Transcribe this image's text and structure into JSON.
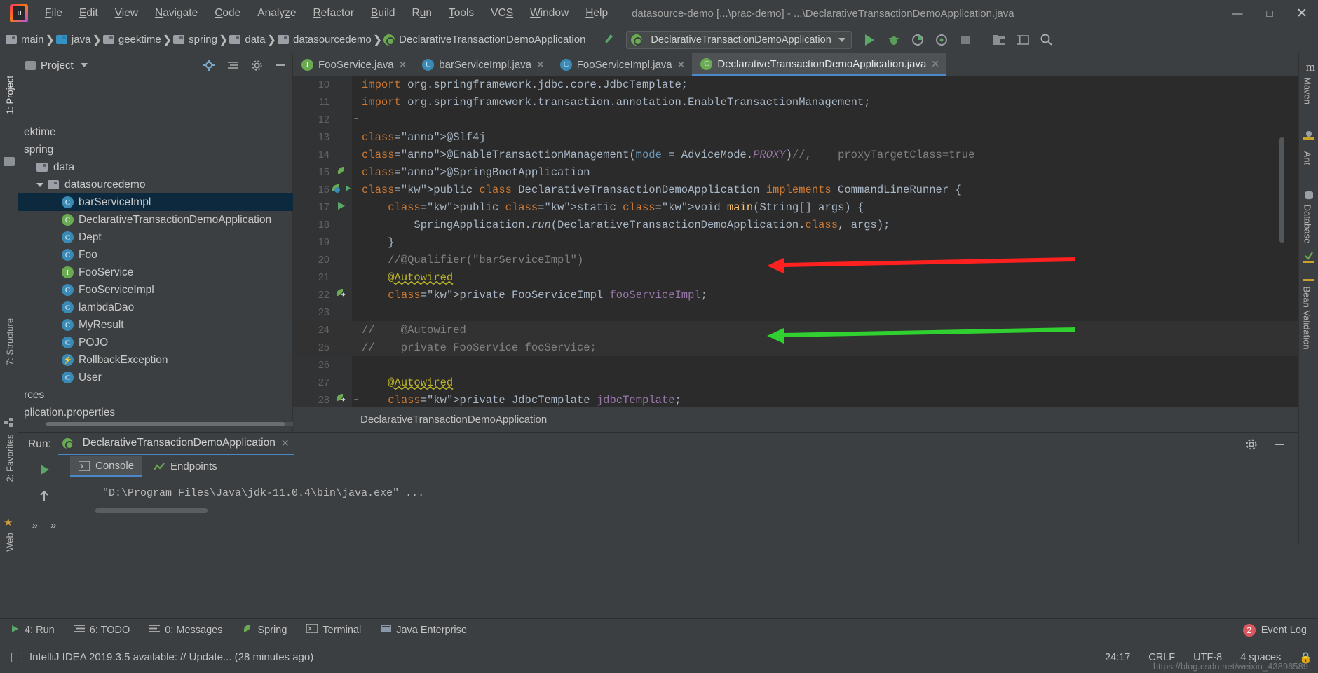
{
  "window": {
    "title": "datasource-demo [...\\prac-demo] - ...\\DeclarativeTransactionDemoApplication.java",
    "minimize": "—",
    "maximize": "□",
    "close": "✕",
    "logo_text": "IJ"
  },
  "menu": {
    "items": [
      {
        "label": "File",
        "mn": "F"
      },
      {
        "label": "Edit",
        "mn": "E"
      },
      {
        "label": "View",
        "mn": "V"
      },
      {
        "label": "Navigate",
        "mn": "N"
      },
      {
        "label": "Code",
        "mn": "C"
      },
      {
        "label": "Analyze",
        "mn": "z"
      },
      {
        "label": "Refactor",
        "mn": "R"
      },
      {
        "label": "Build",
        "mn": "B"
      },
      {
        "label": "Run",
        "mn": "u"
      },
      {
        "label": "Tools",
        "mn": "T"
      },
      {
        "label": "VCS",
        "mn": "S"
      },
      {
        "label": "Window",
        "mn": "W"
      },
      {
        "label": "Help",
        "mn": "H"
      }
    ]
  },
  "navbar": {
    "crumbs": [
      {
        "label": "main",
        "icon": "folder-icon"
      },
      {
        "label": "java",
        "icon": "folder-blue-icon"
      },
      {
        "label": "geektime",
        "icon": "folder-icon"
      },
      {
        "label": "spring",
        "icon": "folder-icon"
      },
      {
        "label": "data",
        "icon": "folder-icon"
      },
      {
        "label": "datasourcedemo",
        "icon": "folder-icon"
      },
      {
        "label": "DeclarativeTransactionDemoApplication",
        "icon": "spring-class-icon"
      }
    ],
    "run_config": "DeclarativeTransactionDemoApplication",
    "toolbar_icons": [
      "run-icon",
      "debug-icon",
      "run-coverage-icon",
      "profiler-icon",
      "stop-icon",
      "project-structure-icon",
      "settings-icon",
      "search-icon"
    ],
    "build_icon": "hammer-icon"
  },
  "left_strip": {
    "tabs": [
      "1: Project",
      "7: Structure",
      "2: Favorites"
    ]
  },
  "right_strip": {
    "tabs": [
      "Maven",
      "Ant",
      "Database",
      "Bean Validation"
    ]
  },
  "project_panel": {
    "title": "Project",
    "header_icons": [
      "locate-icon",
      "collapse-all-icon",
      "gear-icon",
      "hide-icon"
    ],
    "tree": [
      {
        "label": "ektime",
        "indent": 0,
        "icon": "none",
        "selected": false,
        "expander": false
      },
      {
        "label": "spring",
        "indent": 0,
        "icon": "none",
        "selected": false,
        "expander": false
      },
      {
        "label": "data",
        "indent": 1,
        "icon": "folder",
        "selected": false,
        "expander": false
      },
      {
        "label": "datasourcedemo",
        "indent": 1,
        "icon": "folder",
        "selected": false,
        "expander": true
      },
      {
        "label": "barServiceImpl",
        "indent": 3,
        "icon": "class",
        "selected": true,
        "expander": false
      },
      {
        "label": "DeclarativeTransactionDemoApplication",
        "indent": 3,
        "icon": "spring",
        "selected": false,
        "expander": false
      },
      {
        "label": "Dept",
        "indent": 3,
        "icon": "class",
        "selected": false,
        "expander": false
      },
      {
        "label": "Foo",
        "indent": 3,
        "icon": "class",
        "selected": false,
        "expander": false
      },
      {
        "label": "FooService",
        "indent": 3,
        "icon": "interface",
        "selected": false,
        "expander": false
      },
      {
        "label": "FooServiceImpl",
        "indent": 3,
        "icon": "class",
        "selected": false,
        "expander": false
      },
      {
        "label": "lambdaDao",
        "indent": 3,
        "icon": "class",
        "selected": false,
        "expander": false
      },
      {
        "label": "MyResult",
        "indent": 3,
        "icon": "class",
        "selected": false,
        "expander": false
      },
      {
        "label": "POJO",
        "indent": 3,
        "icon": "class",
        "selected": false,
        "expander": false
      },
      {
        "label": "RollbackException",
        "indent": 3,
        "icon": "exception",
        "selected": false,
        "expander": false
      },
      {
        "label": "User",
        "indent": 3,
        "icon": "class",
        "selected": false,
        "expander": false
      },
      {
        "label": "rces",
        "indent": 0,
        "icon": "none",
        "selected": false,
        "expander": false
      },
      {
        "label": "plication.properties",
        "indent": 0,
        "icon": "none",
        "selected": false,
        "expander": false
      }
    ]
  },
  "editor": {
    "tabs": [
      {
        "label": "FooService.java",
        "icon": "interface",
        "active": false,
        "close": "✕"
      },
      {
        "label": "barServiceImpl.java",
        "icon": "class",
        "active": false,
        "close": "✕"
      },
      {
        "label": "FooServiceImpl.java",
        "icon": "class",
        "active": false,
        "close": "✕"
      },
      {
        "label": "DeclarativeTransactionDemoApplication.java",
        "icon": "spring",
        "active": true,
        "close": "✕"
      }
    ],
    "breadcrumb": "DeclarativeTransactionDemoApplication",
    "lines": [
      {
        "n": "10",
        "gutter": "",
        "fold": "",
        "text": "import org.springframework.jdbc.core.JdbcTemplate;"
      },
      {
        "n": "11",
        "gutter": "",
        "fold": "−",
        "text": "import org.springframework.transaction.annotation.EnableTransactionManagement;"
      },
      {
        "n": "12",
        "gutter": "",
        "fold": "",
        "text": ""
      },
      {
        "n": "13",
        "gutter": "",
        "fold": "−",
        "text": "@Slf4j"
      },
      {
        "n": "14",
        "gutter": "",
        "fold": "",
        "text": "@EnableTransactionManagement(mode = AdviceMode.PROXY)//,    proxyTargetClass=true"
      },
      {
        "n": "15",
        "gutter": "spring",
        "fold": "−",
        "text": "@SpringBootApplication"
      },
      {
        "n": "16",
        "gutter": "spring-run",
        "fold": "",
        "text": "public class DeclarativeTransactionDemoApplication implements CommandLineRunner {"
      },
      {
        "n": "17",
        "gutter": "run",
        "fold": "−",
        "text": "    public static void main(String[] args) {"
      },
      {
        "n": "18",
        "gutter": "",
        "fold": "",
        "text": "        SpringApplication.run(DeclarativeTransactionDemoApplication.class, args);"
      },
      {
        "n": "19",
        "gutter": "",
        "fold": "−",
        "text": "    }"
      },
      {
        "n": "20",
        "gutter": "",
        "fold": "",
        "text": "    //@Qualifier(\"barServiceImpl\")"
      },
      {
        "n": "21",
        "gutter": "",
        "fold": "",
        "text": "    @Autowired"
      },
      {
        "n": "22",
        "gutter": "bean",
        "fold": "",
        "text": "    private FooServiceImpl fooServiceImpl;"
      },
      {
        "n": "23",
        "gutter": "",
        "fold": "",
        "text": ""
      },
      {
        "n": "24",
        "gutter": "",
        "fold": "−",
        "text": "//    @Autowired"
      },
      {
        "n": "25",
        "gutter": "",
        "fold": "−",
        "text": "//    private FooService fooService;"
      },
      {
        "n": "26",
        "gutter": "",
        "fold": "",
        "text": ""
      },
      {
        "n": "27",
        "gutter": "",
        "fold": "",
        "text": "    @Autowired"
      },
      {
        "n": "28",
        "gutter": "bean",
        "fold": "",
        "text": "    private JdbcTemplate jdbcTemplate;"
      }
    ]
  },
  "run_panel": {
    "label": "Run:",
    "config_name": "DeclarativeTransactionDemoApplication",
    "close": "✕",
    "tabs": [
      {
        "label": "Console",
        "icon": "console-icon",
        "active": true
      },
      {
        "label": "Endpoints",
        "icon": "endpoints-icon",
        "active": false
      }
    ],
    "side_icons": [
      "rerun-icon",
      "scroll-up-icon",
      "more-icon",
      "more2-icon"
    ],
    "console_text": "\"D:\\Program Files\\Java\\jdk-11.0.4\\bin\\java.exe\" ...",
    "right_icons": [
      "gear-icon",
      "hide-icon"
    ]
  },
  "bottom_bar": {
    "items": [
      {
        "label": "4: Run",
        "mn": "4",
        "icon": "run-icon"
      },
      {
        "label": "6: TODO",
        "mn": "6",
        "icon": "todo-icon"
      },
      {
        "label": "0: Messages",
        "mn": "0",
        "icon": "messages-icon"
      },
      {
        "label": "Spring",
        "mn": "",
        "icon": "spring-icon"
      },
      {
        "label": "Terminal",
        "mn": "",
        "icon": "terminal-icon"
      },
      {
        "label": "Java Enterprise",
        "mn": "",
        "icon": "java-ee-icon"
      }
    ],
    "event_log": {
      "label": "Event Log",
      "count": "2"
    }
  },
  "status_bar": {
    "message": "IntelliJ IDEA 2019.3.5 available: // Update... (28 minutes ago)",
    "caret": "24:17",
    "line_sep": "CRLF",
    "encoding": "UTF-8",
    "indent": "4 spaces",
    "watermark": "https://blog.csdn.net/weixin_43896589"
  },
  "colors": {
    "bg": "#3c3f41",
    "editor_bg": "#2b2b2b",
    "accent_blue": "#4a88c7",
    "green": "#59a869",
    "selection": "#0d293e",
    "arrow_red": "#ff2020",
    "arrow_green": "#2fd02f"
  }
}
